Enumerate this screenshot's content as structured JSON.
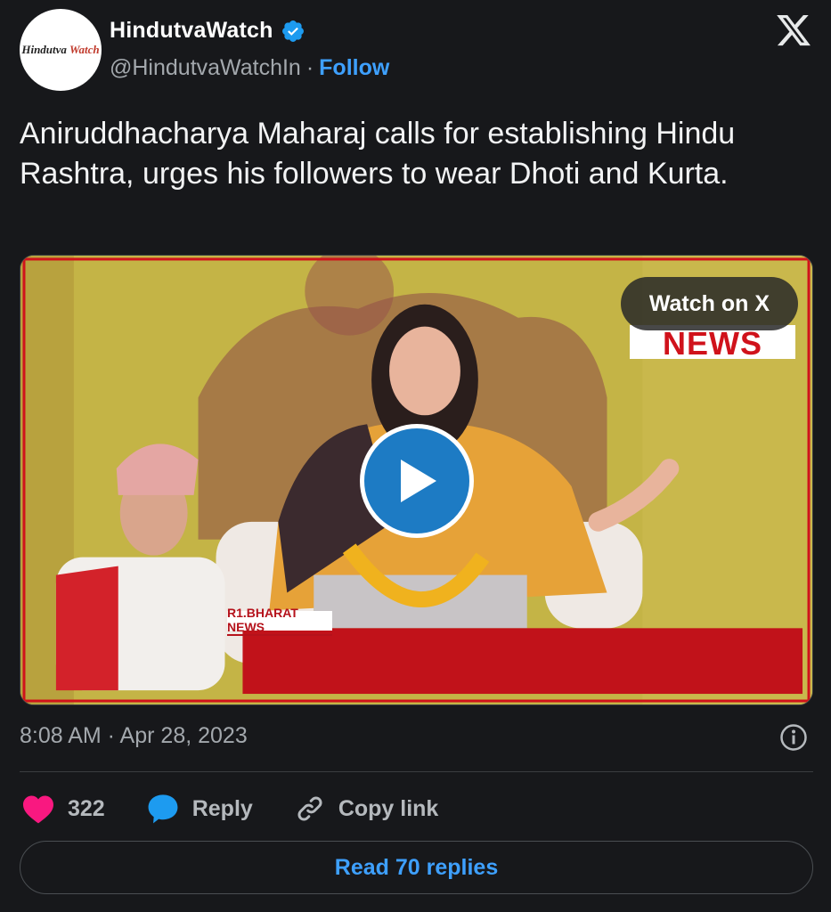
{
  "author": {
    "display_name": "HindutvaWatch",
    "handle": "@HindutvaWatchIn",
    "separator": "·",
    "follow_label": "Follow",
    "verified": true,
    "avatar_text_main": "Hindutva ",
    "avatar_text_accent": "Watch"
  },
  "tweet": {
    "text": "Aniruddhacharya Maharaj calls for establishing Hindu Rashtra, urges his followers to wear Dhoti and Kurta.",
    "timestamp": "8:08 AM · Apr 28, 2023"
  },
  "media": {
    "watch_label": "Watch on X",
    "news_logo_text": "NEWS",
    "ticker_label": "R1.BHARAT NEWS"
  },
  "actions": {
    "like_count": "322",
    "reply_label": "Reply",
    "copy_link_label": "Copy link",
    "read_replies_label": "Read 70 replies"
  },
  "colors": {
    "background": "#17181b",
    "link": "#3ea0ff",
    "heart": "#f91880",
    "reply_icon": "#1d9bf0",
    "verified": "#1d9bf0"
  },
  "icons": [
    "verified-badge-icon",
    "x-logo-icon",
    "play-icon",
    "info-icon",
    "heart-icon",
    "reply-bubble-icon",
    "link-icon"
  ]
}
